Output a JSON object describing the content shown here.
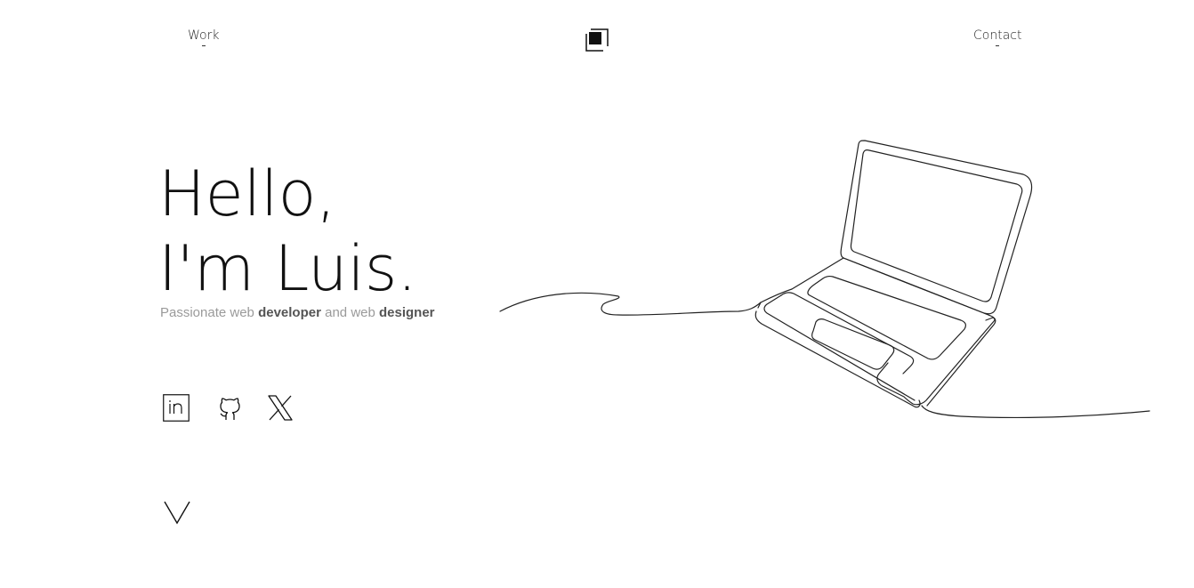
{
  "nav": {
    "work_label": "Work",
    "contact_label": "Contact"
  },
  "hero": {
    "greeting_line1": "Hello,",
    "greeting_line2": "I'm Luis.",
    "tagline": {
      "part1": "Passionate web ",
      "bold1": "developer",
      "part2": " and web ",
      "bold2": "designer"
    }
  },
  "social": [
    {
      "icon": "linkedin-icon"
    },
    {
      "icon": "github-icon"
    },
    {
      "icon": "x-icon"
    }
  ],
  "scroll": {
    "icon": "chevron-down-icon"
  },
  "illustration": {
    "icon": "laptop-line-illustration"
  }
}
